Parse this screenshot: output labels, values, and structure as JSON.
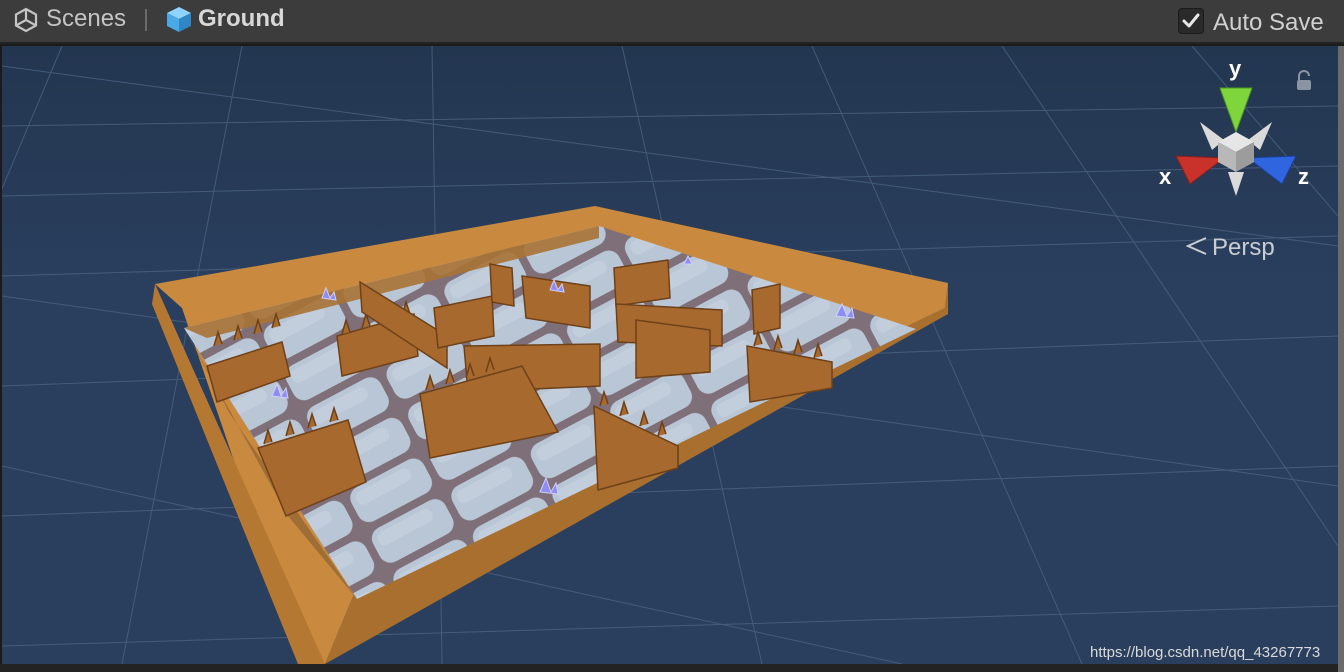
{
  "toolbar": {
    "scenes_label": "Scenes",
    "object_name": "Ground",
    "autosave_label": "Auto Save",
    "autosave_checked": true,
    "icons": [
      "unity-logo-icon",
      "cube-icon",
      "checkmark-icon"
    ]
  },
  "viewport": {
    "projection_label": "Persp",
    "gizmo": {
      "y": "y",
      "x": "x",
      "z": "z"
    },
    "lock_icon": "lock-icon",
    "background_color": "#2a3f5e",
    "grid_color": "#4d6684",
    "board_wood_color": "#c98a3f",
    "fence_color": "#a8692f",
    "axis_colors": {
      "x": "#c8322a",
      "y": "#7fd63c",
      "z": "#2f66e0"
    }
  },
  "watermark": "https://blog.csdn.net/qq_43267773"
}
